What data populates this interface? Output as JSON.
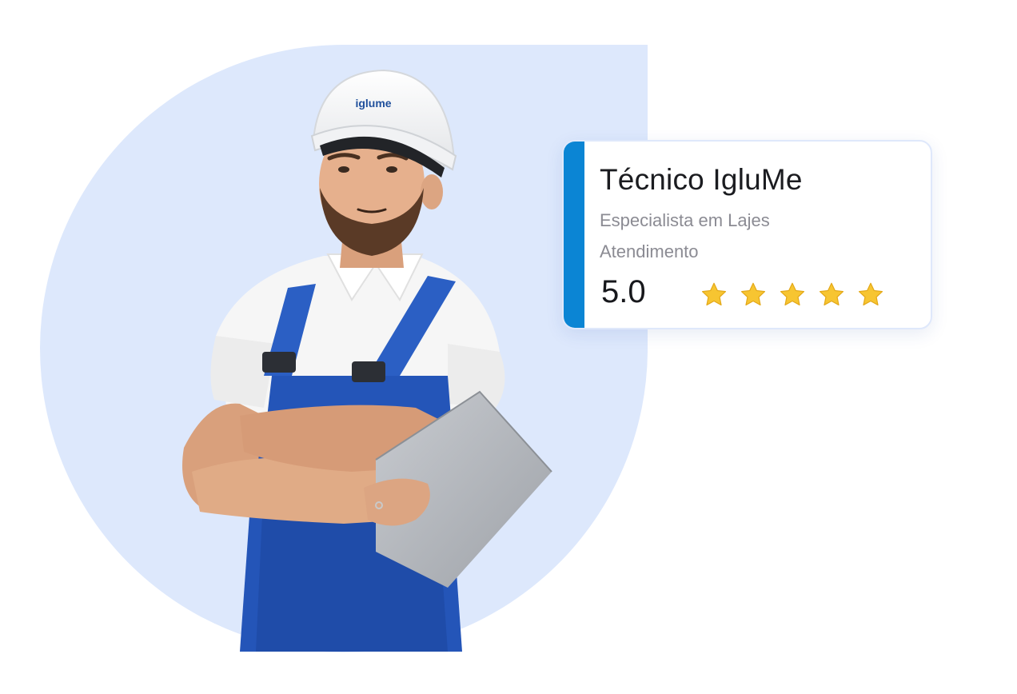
{
  "helmet_logo_text": "iglume",
  "card": {
    "title": "Técnico IgluMe",
    "specialty": "Especialista em Lajes",
    "service_label": "Atendimento",
    "score": "5.0",
    "rating_stars": 5,
    "accent_color": "#0b85d4",
    "star_color": "#f7c531"
  },
  "colors": {
    "backdrop": "#dde8fc",
    "helmet": "#f5f5f5",
    "overalls": "#2455b8",
    "shirt": "#f7f7f7",
    "tablet": "#b2b5ba"
  },
  "icons": [
    "star-icon"
  ]
}
